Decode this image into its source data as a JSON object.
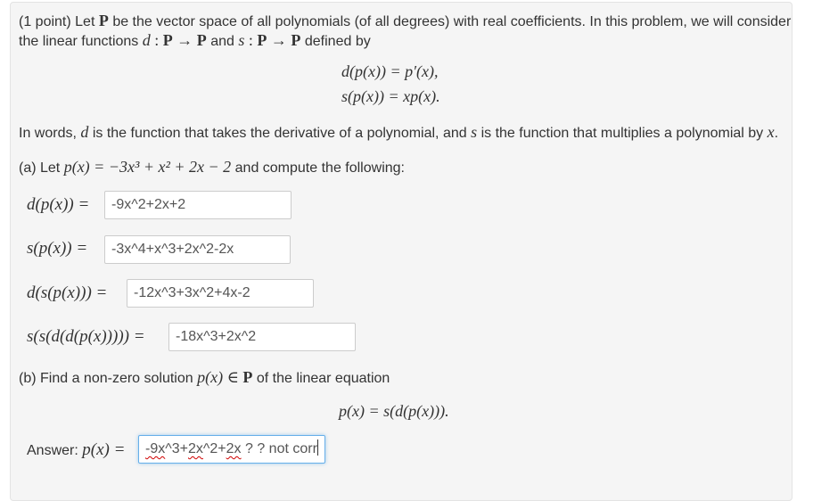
{
  "intro": {
    "points": "(1 point)",
    "t1": "Let",
    "P": "P",
    "t2": "be the vector space of all polynomials (of all degrees) with real coefficients. In this problem, we will consider",
    "t3": "the linear functions",
    "d": "d",
    "colon": " : ",
    "arrow": "→",
    "and": "and",
    "s": "s",
    "t4": "defined by"
  },
  "definitions": {
    "d_def": "d(p(x)) = p′(x),",
    "s_def": "s(p(x)) = xp(x)."
  },
  "words": {
    "t1": "In words,",
    "d": "d",
    "t2": "is the function that takes the derivative of a polynomial, and",
    "s": "s",
    "t3": "is the function that multiplies a polynomial by",
    "x": "x",
    "period": "."
  },
  "part_a": {
    "t1": "(a) Let",
    "px": "p(x) = −3x³ + x² + 2x − 2",
    "t2": "and compute the following:",
    "items": [
      {
        "lhs": "d(p(x)) =",
        "value": "-9x^2+2x+2"
      },
      {
        "lhs": "s(p(x)) =",
        "value": "-3x^4+x^3+2x^2-2x"
      },
      {
        "lhs": "d(s(p(x))) =",
        "value": "-12x^3+3x^2+4x-2"
      },
      {
        "lhs": "s(s(d(d(p(x))))) =",
        "value": "-18x^3+2x^2"
      }
    ]
  },
  "part_b": {
    "t1": "(b) Find a non-zero solution",
    "px": "p(x) ∈",
    "P": "P",
    "t2": "of the linear equation",
    "equation": "p(x) = s(d(p(x))).",
    "answer_label": "Answer:",
    "answer_lhs": "p(x) =",
    "answer_parts": [
      "-9x",
      "^3+",
      "2x",
      "^2+",
      "2x",
      " ? ? not corr"
    ]
  }
}
